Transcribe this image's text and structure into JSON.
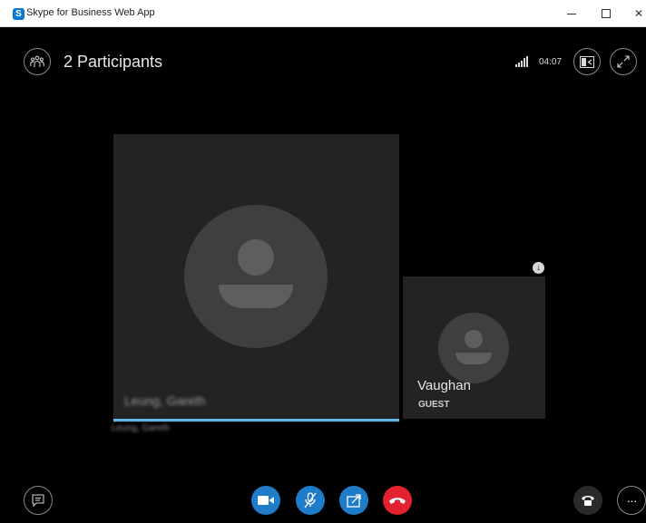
{
  "window": {
    "title": "Skype for Business Web App",
    "logo_letter": "S",
    "controls": {
      "close_glyph": "✕"
    }
  },
  "header": {
    "participants_label": "2 Participants",
    "timer": "04:07",
    "icons": {
      "participants": "people-icon",
      "signal": "signal-strength-icon",
      "layout": "layout-icon",
      "fullscreen": "expand-icon"
    }
  },
  "main_tile": {
    "name_blurred": "Leung, Gareth",
    "sub_name_blurred": "Leung, Gareth",
    "speaking_color": "#61b5e3"
  },
  "guest_tile": {
    "name": "Vaughan",
    "role": "GUEST",
    "pin_glyph": "↓"
  },
  "controls": {
    "chat": "chat-icon",
    "video": "video-camera-icon",
    "mute": "microphone-muted-icon",
    "share": "share-screen-icon",
    "hangup": "hang-up-icon",
    "phone": "phone-icon",
    "more_glyph": "···",
    "colors": {
      "action": "#1e7cc9",
      "hangup": "#e3222f"
    }
  }
}
